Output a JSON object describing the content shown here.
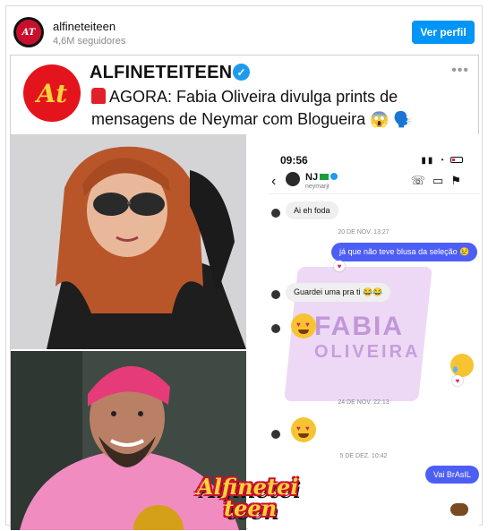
{
  "header": {
    "username": "alfineteiteen",
    "followers": "4,6M seguidores",
    "follow_button": "Ver perfil",
    "avatar_text": "AT"
  },
  "post": {
    "logo_text": "At",
    "brand": "ALFINETEITEEN",
    "headline": "AGORA: Fabia Oliveira divulga prints de mensagens de Neymar com Blogueira",
    "headline_emojis": "😱 🗣️",
    "stamp_line1": "Alfinetei",
    "stamp_line2": "teen"
  },
  "chat": {
    "time": "09:56",
    "contact_name": "NJ",
    "contact_user": "neymarjr",
    "messages": [
      {
        "dir": "in",
        "text": "Ai eh foda"
      },
      {
        "dir": "ts",
        "text": "20 DE NOV. 13:27"
      },
      {
        "dir": "out",
        "text": "já que não teve blusa da seleção 😢"
      },
      {
        "dir": "in",
        "text": "Guardei uma pra ti 😂😂"
      },
      {
        "dir": "ts",
        "text": "24 DE NOV. 22:13"
      },
      {
        "dir": "ts",
        "text": "5 DE DEZ. 10:42"
      },
      {
        "dir": "out",
        "text": "Vai BrAsIL"
      }
    ],
    "watermark_line1": "FABIA",
    "watermark_line2": "OLIVEIRA"
  },
  "colors": {
    "follow_button": "#0095f6",
    "outgoing_bubble": "#4d5ef5",
    "brand_red": "#e3141c",
    "verified_blue": "#1d9bf0"
  }
}
